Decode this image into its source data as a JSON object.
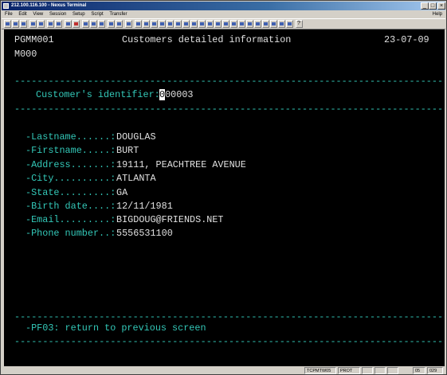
{
  "window": {
    "title": "212.100.116.100 - Nexus Terminal",
    "minimize": "_",
    "maximize": "□",
    "close": "×"
  },
  "menu": [
    "File",
    "Edit",
    "View",
    "Session",
    "Setup",
    "Script",
    "Transfer"
  ],
  "menu_help": "Help",
  "screen": {
    "program": "PGMM001",
    "title": "Customers detailed information",
    "date": "23-07-09",
    "message": "M000",
    "separator": "----------------------------------------------------------------------------------",
    "identifier_label": "Customer's identifier:",
    "identifier_cursor": "0",
    "identifier_rest": "00003",
    "fields": [
      {
        "label": "-Lastname......:",
        "value": "DOUGLAS"
      },
      {
        "label": "-Firstname.....:",
        "value": "BURT"
      },
      {
        "label": "-Address.......:",
        "value": "19111, PEACHTREE AVENUE"
      },
      {
        "label": "-City..........:",
        "value": "ATLANTA"
      },
      {
        "label": "-State.........:",
        "value": "GA"
      },
      {
        "label": "-Birth date....:",
        "value": "12/11/1981"
      },
      {
        "label": "-Email.........:",
        "value": "BIGDOUG@FRIENDS.NET"
      },
      {
        "label": "-Phone number..:",
        "value": "5556531100"
      }
    ],
    "pf03": "-PF03: return to previous screen"
  },
  "status": {
    "host": "TCPMTW05",
    "mode": "PROT",
    "pos": "05",
    "col": "029"
  },
  "colors": {
    "terminal_bg": "#000000",
    "text": "#e0e0e0",
    "accent": "#33c8b8"
  }
}
